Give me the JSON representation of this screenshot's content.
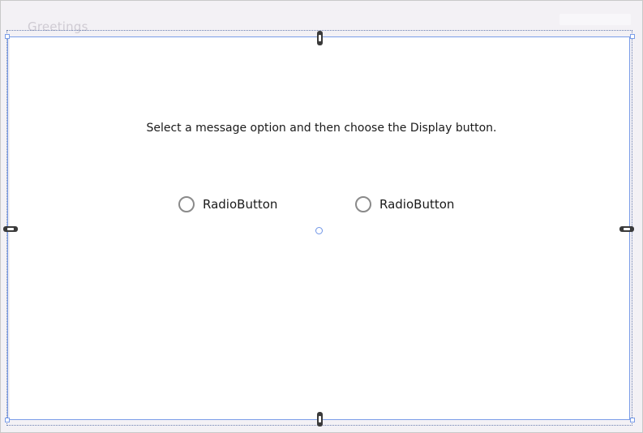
{
  "window": {
    "title": "Greetings"
  },
  "designer": {
    "instruction_text": "Select a message option and then choose the Display button.",
    "radio_buttons": [
      {
        "label": "RadioButton",
        "selected": false
      },
      {
        "label": "RadioButton",
        "selected": false
      }
    ]
  },
  "colors": {
    "selection_border": "#7a9de8",
    "anchor_handle": "#3a3a3a",
    "window_chrome": "#f3f1f5"
  }
}
